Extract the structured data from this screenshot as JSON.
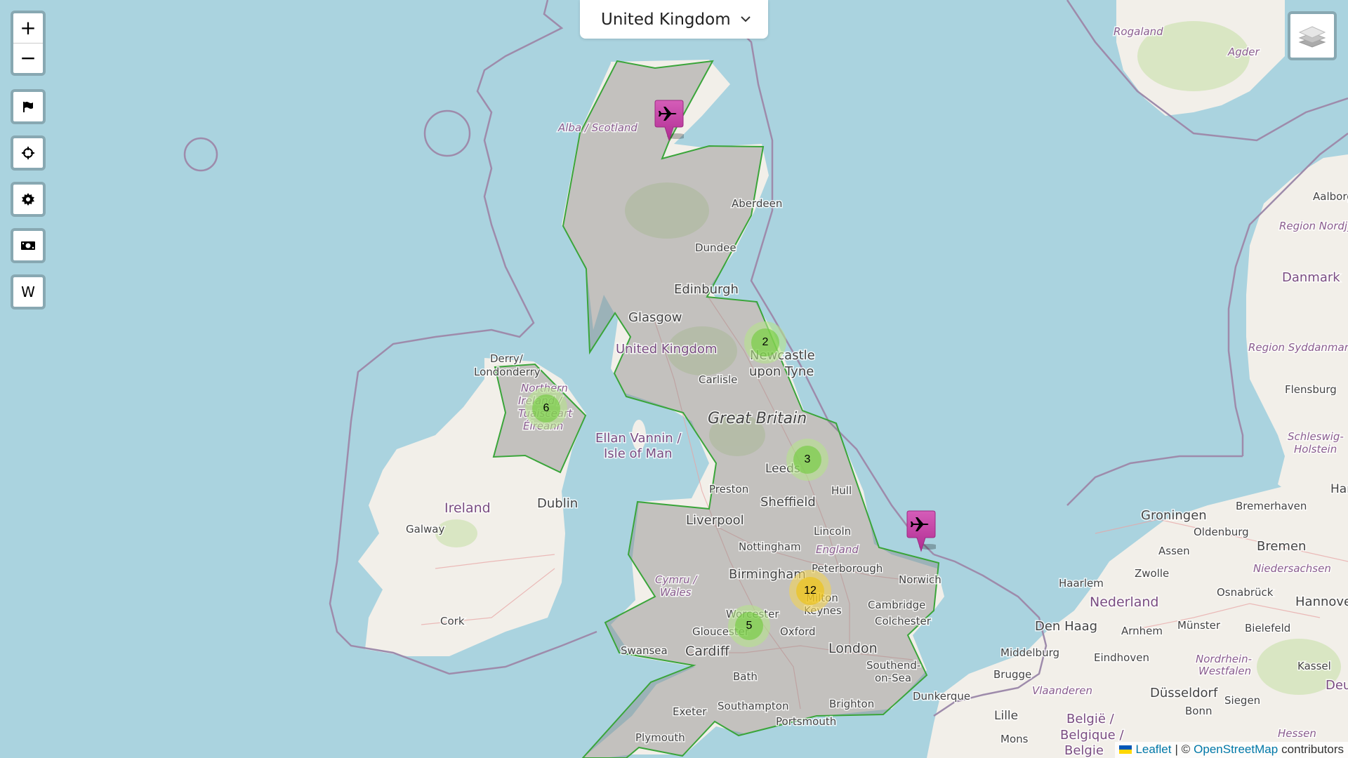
{
  "colors": {
    "water": "#aad3df",
    "land": "#f2efe9",
    "land_green": "#cfe3b2",
    "border": "#9e8bab",
    "polygon_stroke": "#3aa53a",
    "polygon_fill": "#8a8a8a",
    "marker": "#c0399f",
    "cluster_small": "#6ecc39",
    "cluster_medium": "#f0c20c",
    "link": "#0078a8"
  },
  "controls": {
    "zoom_in": "+",
    "zoom_out": "−",
    "buttons": [
      {
        "name": "flag",
        "icon": "flag-icon"
      },
      {
        "name": "locate",
        "icon": "crosshair-icon"
      },
      {
        "name": "settings",
        "icon": "gear-icon"
      },
      {
        "name": "money",
        "icon": "banknote-icon"
      },
      {
        "name": "wiki",
        "icon": "w-letter-icon",
        "label": "W"
      }
    ]
  },
  "country_select": {
    "selected": "United Kingdom"
  },
  "layers_control": {
    "icon": "layers-icon"
  },
  "attribution": {
    "leaflet": "Leaflet",
    "separator": "| ©",
    "osm": "OpenStreetMap",
    "suffix": "contributors"
  },
  "clusters": [
    {
      "count": "2",
      "size": "small",
      "near": "Newcastle upon Tyne"
    },
    {
      "count": "3",
      "size": "small",
      "near": "Leeds"
    },
    {
      "count": "6",
      "size": "small",
      "near": "Northern Ireland"
    },
    {
      "count": "12",
      "size": "medium",
      "near": "Milton Keynes"
    },
    {
      "count": "5",
      "size": "small",
      "near": "Worcester"
    }
  ],
  "markers": [
    {
      "type": "airport",
      "icon": "airplane-icon",
      "near": "Inverness"
    },
    {
      "type": "airport",
      "icon": "airplane-icon",
      "near": "Norfolk coast"
    }
  ],
  "labels": {
    "scotland": "Alba / Scotland",
    "aberdeen": "Aberdeen",
    "dundee": "Dundee",
    "edinburgh": "Edinburgh",
    "glasgow": "Glasgow",
    "uk": "United Kingdom",
    "newcastle1": "Newcastle",
    "newcastle2": "upon Tyne",
    "carlisle": "Carlisle",
    "great_britain": "Great Britain",
    "derry1": "Derry/",
    "derry2": "Londonderry",
    "ni1": "Northern",
    "ni2": "Ireland /",
    "ni3": "Tuaisceart",
    "ni4": "Éireann",
    "iom1": "Ellan Vannin /",
    "iom2": "Isle of Man",
    "ireland": "Ireland",
    "dublin": "Dublin",
    "galway": "Galway",
    "cork": "Cork",
    "leeds": "Leeds",
    "hull": "Hull",
    "preston": "Preston",
    "sheffield": "Sheffield",
    "liverpool": "Liverpool",
    "nottingham": "Nottingham",
    "lincoln": "Lincoln",
    "england": "England",
    "peterborough": "Peterborough",
    "birmingham": "Birmingham",
    "norwich": "Norwich",
    "wales1": "Cymru /",
    "wales2": "Wales",
    "milton1": "Milton",
    "milton2": "Keynes",
    "cambridge": "Cambridge",
    "worcester": "Worcester",
    "colchester": "Colchester",
    "gloucester": "Gloucester",
    "oxford": "Oxford",
    "london": "London",
    "swansea": "Swansea",
    "cardiff": "Cardiff",
    "southend1": "Southend-",
    "southend2": "on-Sea",
    "bath": "Bath",
    "dunkerque": "Dunkerque",
    "exeter": "Exeter",
    "southampton": "Southampton",
    "brighton": "Brighton",
    "portsmouth": "Portsmouth",
    "plymouth": "Plymouth",
    "rogaland": "Rogaland",
    "agder": "Agder",
    "aalborg": "Aalborg",
    "nordjylland": "Region Nordjyl",
    "danmark": "Danmark",
    "syddanmark": "Region Syddanmark",
    "flensburg": "Flensburg",
    "schleswig1": "Schleswig-",
    "schleswig2": "Holstein",
    "hamburg": "Hamb",
    "groningen": "Groningen",
    "bremerhaven": "Bremerhaven",
    "oldenburg": "Oldenburg",
    "bremen": "Bremen",
    "assen": "Assen",
    "niedersachsen": "Niedersachsen",
    "zwolle": "Zwolle",
    "haarlem": "Haarlem",
    "nederland": "Nederland",
    "osnabruck": "Osnabrück",
    "hannover": "Hannove",
    "denhaag": "Den Haag",
    "arnhem": "Arnhem",
    "munster": "Münster",
    "bielefeld": "Bielefeld",
    "middelburg": "Middelburg",
    "eindhoven": "Eindhoven",
    "nrw1": "Nordrhein-",
    "nrw2": "Westfalen",
    "kassel": "Kassel",
    "brugge": "Brugge",
    "vlaanderen": "Vlaanderen",
    "dusseldorf": "Düsseldorf",
    "deu": "Deu",
    "lille": "Lille",
    "belgie1": "België /",
    "belgie2": "Belgique /",
    "belgie3": "Belgie",
    "bonn": "Bonn",
    "siegen": "Siegen",
    "hessen": "Hessen",
    "mons": "Mons"
  }
}
